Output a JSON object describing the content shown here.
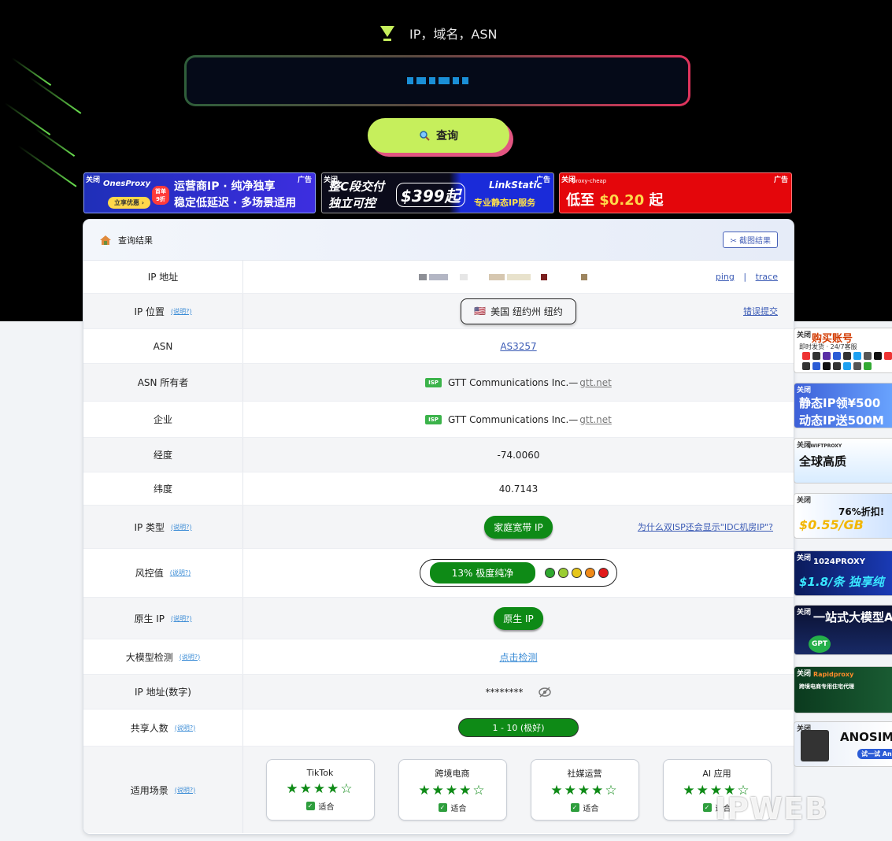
{
  "search": {
    "hint": "IP，域名，ASN",
    "button_label": "查询"
  },
  "ads_top": [
    {
      "close": "关闭",
      "tag": "广告",
      "brand": "OnesProxy",
      "line1": "运营商IP · 纯净独享",
      "line2": "稳定低延迟 · 多场景适用",
      "cta": "立享优惠 ›",
      "badge": "首单 9折"
    },
    {
      "close": "关闭",
      "tag": "广告",
      "line1": "整C段交付",
      "line2": "独立可控",
      "price": "$399起",
      "brand": "LinkStatic",
      "sub": "专业静态IP服务"
    },
    {
      "close": "关闭",
      "tag": "广告",
      "brand": "proxy-cheap",
      "headline_prefix": "低至 ",
      "headline_price": "$0.20",
      "headline_suffix": " 起"
    }
  ],
  "panel": {
    "title": "查询结果",
    "screenshot_label": "✂ 截图结果",
    "help_label": "(说明?)"
  },
  "rows": {
    "ip": {
      "label": "IP 地址",
      "ping": "ping",
      "sep": "|",
      "trace": "trace"
    },
    "location": {
      "label": "IP 位置",
      "flag": "🇺🇸",
      "value": "美国 纽约州 纽约",
      "report": "错误提交"
    },
    "asn": {
      "label": "ASN",
      "value": "AS3257"
    },
    "asn_owner": {
      "label": "ASN 所有者",
      "badge": "ISP",
      "name": "GTT Communications Inc.—",
      "domain": "gtt.net"
    },
    "company": {
      "label": "企业",
      "badge": "ISP",
      "name": "GTT Communications Inc.—",
      "domain": "gtt.net"
    },
    "longitude": {
      "label": "经度",
      "value": "-74.0060"
    },
    "latitude": {
      "label": "纬度",
      "value": "40.7143"
    },
    "ip_type": {
      "label": "IP 类型",
      "value": "家庭宽带 IP",
      "question": "为什么双ISP还会显示\"IDC机房IP\"?"
    },
    "risk": {
      "label": "风控值",
      "value": "13%  极度纯净"
    },
    "native": {
      "label": "原生 IP",
      "value": "原生 IP"
    },
    "llm": {
      "label": "大模型检测",
      "value": "点击检测"
    },
    "ip_numeric": {
      "label": "IP 地址(数字)",
      "value": "********"
    },
    "shared": {
      "label": "共享人数",
      "value": "1 - 10 (极好)"
    },
    "scenarios": {
      "label": "适用场景"
    }
  },
  "scenario_cards": [
    {
      "title": "TikTok",
      "stars": "★★★★☆",
      "fit": "适合"
    },
    {
      "title": "跨境电商",
      "stars": "★★★★☆",
      "fit": "适合"
    },
    {
      "title": "社媒运营",
      "stars": "★★★★☆",
      "fit": "适合"
    },
    {
      "title": "AI 应用",
      "stars": "★★★★☆",
      "fit": "适合"
    }
  ],
  "side_ads": [
    {
      "close": "关闭",
      "text": "购买账号",
      "sub": "即时发货 · 24/7客服"
    },
    {
      "close": "关闭",
      "text": "静态IP领¥500",
      "sub": "动态IP送500M"
    },
    {
      "close": "关闭",
      "text": "全球高质",
      "sub": "SWIFTPROXY"
    },
    {
      "close": "关闭",
      "text": "76%折扣!",
      "sub": "$0.55/GB"
    },
    {
      "close": "关闭",
      "text": "1024PROXY",
      "sub": "$1.8/条 独享纯"
    },
    {
      "close": "关闭",
      "text": "一站式大模型AI",
      "sub": "GPT"
    },
    {
      "close": "关闭",
      "text": "Rapidproxy",
      "sub": "跨境电商专用住宅代理"
    },
    {
      "close": "关闭",
      "text": "ANOSIM",
      "sub": "试一试 Ano"
    }
  ],
  "watermark": "IPWEB",
  "colors": {
    "accent_green": "#0e8a16",
    "button_lime": "#c6ef5c",
    "button_shadow": "#e25581",
    "risk_dots": [
      "#2fa82f",
      "#9acd32",
      "#e6c619",
      "#f08a17",
      "#e21b1b"
    ]
  }
}
